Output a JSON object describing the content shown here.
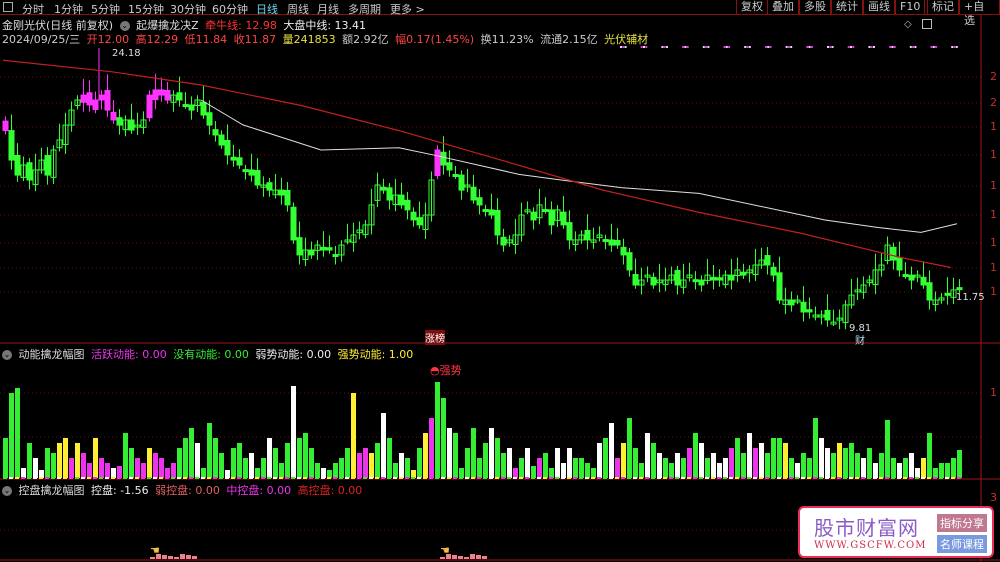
{
  "toolbar": {
    "tabs": [
      "分时",
      "1分钟",
      "5分钟",
      "15分钟",
      "30分钟",
      "60分钟",
      "日线",
      "周线",
      "月线",
      "多周期",
      "更多 >"
    ],
    "active_tab": "日线",
    "right_buttons": [
      "复权",
      "叠加",
      "多股",
      "统计",
      "画线",
      "F10",
      "标记",
      "+自选"
    ]
  },
  "header": {
    "stock": "金刚光伏(日线 前复权)",
    "indicator": "起爆擒龙决Z",
    "qianniu_label": "牵牛线: 12.98",
    "dapan_label": "大盘中线: 13.41",
    "date": "2024/09/25/三",
    "open": "开12.00",
    "high": "高12.29",
    "low": "低11.84",
    "close": "收11.87",
    "volume": "量241853",
    "amount": "额2.92亿",
    "change": "幅0.17(1.45%)",
    "turnover": "换11.23%",
    "float": "流通2.15亿",
    "sector": "光伏辅材"
  },
  "main_chart": {
    "high_label": "24.18",
    "low_label": "9.81",
    "last_label": "11.75",
    "tag_zhangbang": "涨榜",
    "tag_cai": "财",
    "axis_labels": [
      "2",
      "2",
      "1",
      "1",
      "1",
      "1",
      "1",
      "1",
      "1"
    ],
    "closes": [
      20.2,
      18.65,
      17.86,
      18.39,
      17.6,
      18.13,
      18.65,
      17.86,
      19.18,
      19.71,
      20.49,
      21.28,
      21.81,
      22.07,
      21.55,
      21.81,
      22.07,
      21.28,
      20.76,
      20.49,
      20.76,
      20.23,
      20.49,
      20.76,
      22.07,
      22.34,
      22.07,
      21.81,
      22.07,
      21.81,
      21.55,
      21.28,
      21.81,
      21.02,
      20.49,
      19.97,
      19.44,
      18.92,
      18.65,
      18.39,
      18.13,
      17.86,
      17.34,
      17.34,
      17.07,
      17.07,
      16.81,
      16.29,
      14.45,
      13.66,
      13.92,
      13.66,
      14.18,
      13.92,
      13.92,
      13.66,
      14.18,
      14.45,
      14.71,
      14.97,
      15.24,
      16.29,
      17.34,
      17.07,
      16.55,
      16.81,
      16.29,
      16.03,
      15.5,
      15.24,
      15.76,
      17.6,
      19.18,
      18.39,
      18.13,
      17.86,
      17.07,
      17.34,
      16.55,
      16.29,
      16.03,
      15.76,
      14.71,
      14.18,
      14.45,
      14.71,
      15.76,
      16.03,
      15.5,
      16.29,
      16.03,
      15.24,
      16.03,
      15.24,
      14.45,
      14.45,
      14.71,
      14.45,
      14.45,
      14.71,
      14.45,
      14.18,
      14.18,
      13.66,
      12.87,
      12.08,
      12.34,
      12.6,
      12.08,
      12.34,
      12.34,
      12.6,
      12.08,
      12.34,
      12.6,
      12.34,
      12.08,
      12.6,
      12.34,
      12.34,
      12.6,
      12.34,
      12.87,
      12.6,
      12.87,
      13.13,
      13.39,
      13.13,
      12.6,
      11.29,
      11.29,
      11.03,
      11.29,
      10.66,
      10.66,
      10.5,
      10.5,
      10.24,
      10.13,
      10.34,
      11.03,
      11.55,
      11.82,
      12.08,
      12.34,
      12.87,
      13.13,
      14.18,
      13.39,
      12.87,
      12.6,
      12.34,
      12.6,
      12.08,
      11.29,
      11.29,
      11.4,
      11.55,
      11.82,
      11.87
    ],
    "magenta_idx": [
      0,
      13,
      14,
      15,
      16,
      17,
      18,
      24,
      25,
      26,
      27,
      72
    ],
    "ma_white": [
      [
        33,
        21.81
      ],
      [
        40,
        20.5
      ],
      [
        53,
        19.18
      ],
      [
        66,
        19.3
      ],
      [
        72,
        18.9
      ],
      [
        86,
        17.9
      ],
      [
        93,
        17.6
      ],
      [
        103,
        17.2
      ],
      [
        116,
        16.9
      ],
      [
        137,
        15.5
      ],
      [
        146,
        15.1
      ],
      [
        153,
        14.85
      ],
      [
        159,
        15.3
      ]
    ],
    "ma_red": [
      [
        0,
        23.9
      ],
      [
        18,
        23.3
      ],
      [
        33,
        22.6
      ],
      [
        50,
        21.5
      ],
      [
        66,
        20.2
      ],
      [
        83,
        18.65
      ],
      [
        100,
        17.07
      ],
      [
        116,
        15.9
      ],
      [
        133,
        14.8
      ],
      [
        150,
        13.5
      ],
      [
        158,
        13.0
      ]
    ],
    "colors": {
      "up": "#33ff33",
      "magenta": "#ff33ff",
      "white_ma": "#e0e0e0",
      "red_ma": "#c02020",
      "grid": "#6a1010"
    }
  },
  "panel2": {
    "title": "动能擒龙幅图",
    "huoyue": "活跃动能: 0.00",
    "meiyou": "没有动能: 0.00",
    "ruoshi": "弱势动能: 0.00",
    "qiangshi": "强势动能: 1.00",
    "signal": "强势",
    "axis_labels": [
      "1"
    ],
    "volumes": [
      40,
      85,
      90,
      10,
      35,
      20,
      8,
      30,
      25,
      35,
      40,
      20,
      35,
      25,
      15,
      40,
      20,
      15,
      10,
      12,
      45,
      30,
      20,
      15,
      30,
      25,
      20,
      10,
      15,
      30,
      40,
      50,
      35,
      10,
      55,
      40,
      25,
      8,
      30,
      35,
      20,
      25,
      10,
      20,
      40,
      30,
      15,
      35,
      92,
      40,
      45,
      30,
      15,
      10,
      8,
      15,
      20,
      30,
      85,
      25,
      30,
      25,
      35,
      65,
      40,
      15,
      25,
      20,
      8,
      30,
      45,
      60,
      96,
      80,
      50,
      45,
      10,
      30,
      50,
      20,
      35,
      50,
      40,
      25,
      30,
      10,
      20,
      30,
      12,
      20,
      25,
      10,
      30,
      15,
      30,
      20,
      20,
      15,
      10,
      35,
      40,
      55,
      20,
      35,
      60,
      30,
      15,
      45,
      35,
      25,
      20,
      15,
      25,
      20,
      30,
      45,
      35,
      20,
      25,
      15,
      20,
      30,
      40,
      25,
      45,
      30,
      35,
      25,
      40,
      40,
      35,
      20,
      15,
      25,
      20,
      60,
      40,
      30,
      25,
      35,
      30,
      35,
      25,
      20,
      30,
      15,
      25,
      58,
      20,
      15,
      20,
      25,
      10,
      20,
      45,
      10,
      15,
      15,
      20,
      28
    ],
    "vol_colors": "gggwgwwggyymymmymmwmggmmymmmmgggwggggwgggwggwgggwggggwggggymmyg wggwgygymggwggggggwggwmgwgmggwwwggggwgwmygggwgwggwgmgwgwwwmggwmwgggygwgggwwgygggwgwgggwgwwy",
    "colors": {
      "g": "#33ee33",
      "y": "#ffee33",
      "m": "#ee33ee",
      "w": "#ffffff"
    }
  },
  "panel3": {
    "title": "控盘擒龙幅图",
    "kongpan": "控盘: -1.56",
    "ruo": "弱控盘: 0.00",
    "zhong": "中控盘: 0.00",
    "gao": "高控盘: 0.00",
    "axis_labels": [
      "3"
    ]
  },
  "watermark": {
    "name": "股市财富网",
    "url": "WWW.GSCFW.COM",
    "tag1": "指标分享",
    "tag2": "名师课程"
  }
}
